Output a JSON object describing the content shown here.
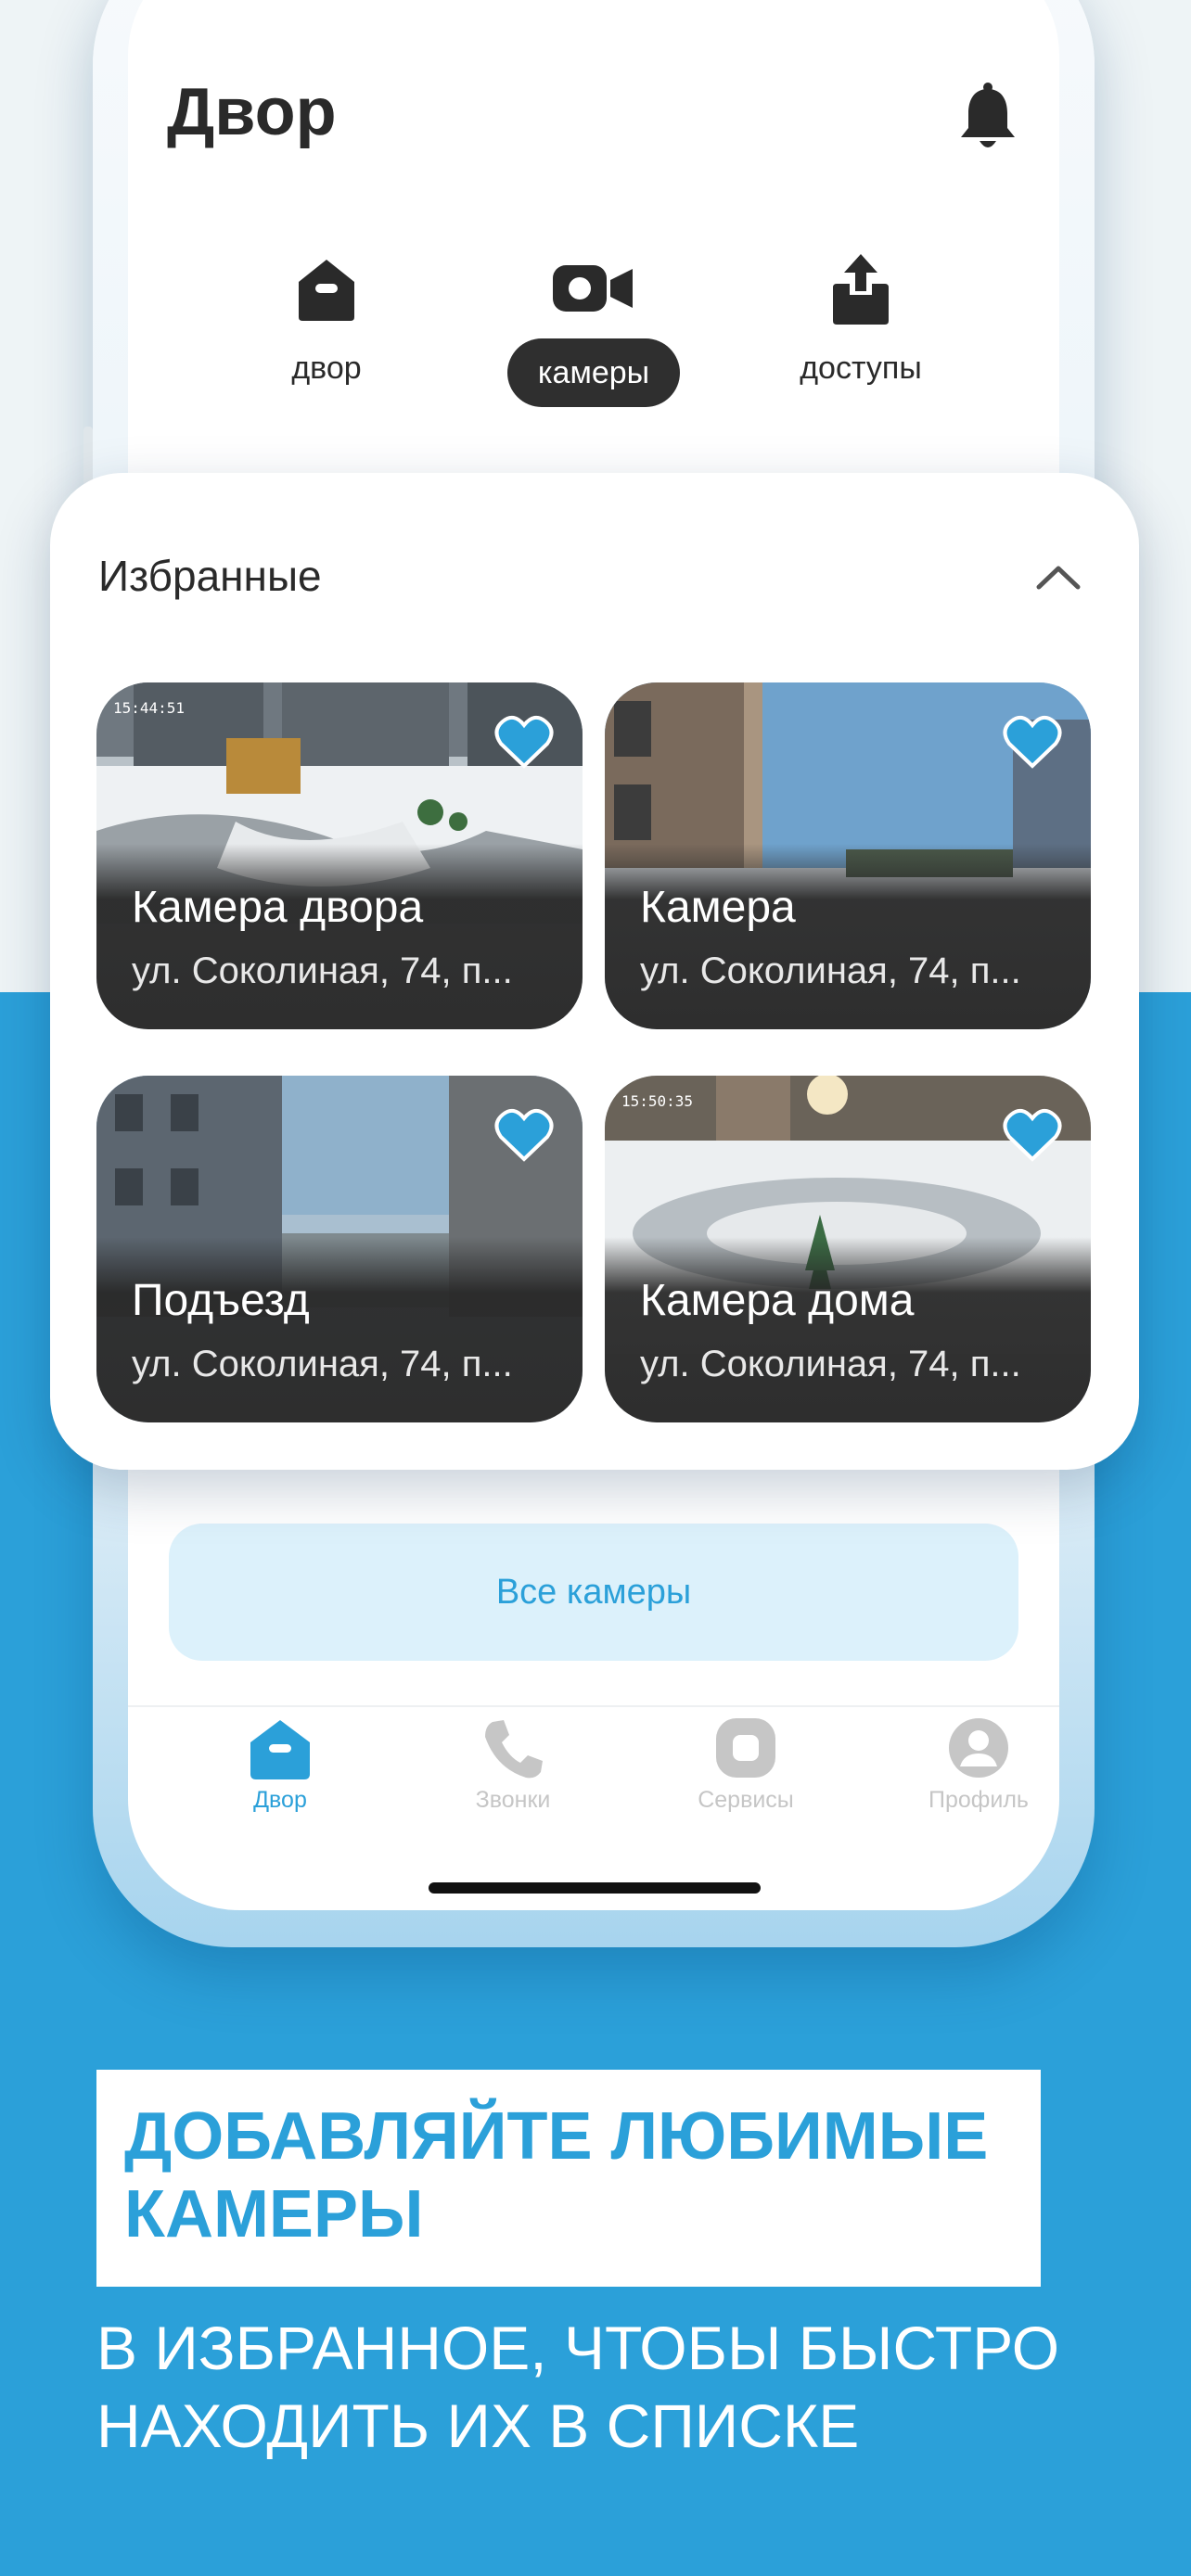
{
  "header": {
    "title": "Двор",
    "bell_icon": "bell-icon"
  },
  "segments": [
    {
      "label": "двор",
      "icon": "home-icon",
      "active": false
    },
    {
      "label": "камеры",
      "icon": "video-camera-icon",
      "active": true
    },
    {
      "label": "доступы",
      "icon": "share-icon",
      "active": false
    }
  ],
  "favorites": {
    "title": "Избранные",
    "collapse_icon": "chevron-up-icon",
    "cameras": [
      {
        "name": "Камера двора",
        "address": "ул. Соколиная, 74, п...",
        "timestamp": "15:44:51",
        "favorite": true
      },
      {
        "name": "Камера",
        "address": "ул. Соколиная, 74, п...",
        "timestamp": "",
        "favorite": true
      },
      {
        "name": "Подъезд",
        "address": "ул. Соколиная, 74, п...",
        "timestamp": "",
        "favorite": true
      },
      {
        "name": "Камера дома",
        "address": "ул. Соколиная, 74, п...",
        "timestamp": "15:50:35",
        "favorite": true
      }
    ]
  },
  "all_cameras_label": "Все камеры",
  "tabbar": [
    {
      "label": "Двор",
      "icon": "home-icon",
      "active": true
    },
    {
      "label": "Звонки",
      "icon": "phone-icon",
      "active": false
    },
    {
      "label": "Сервисы",
      "icon": "services-icon",
      "active": false
    },
    {
      "label": "Профиль",
      "icon": "profile-icon",
      "active": false
    }
  ],
  "promo": {
    "headline": "ДОБАВЛЯЙТЕ ЛЮБИМЫЕ\nКАМЕРЫ",
    "subtext": "В ИЗБРАННОЕ, ЧТОБЫ БЫСТРО\nНАХОДИТЬ ИХ В СПИСКЕ"
  },
  "colors": {
    "accent": "#2ba0d9",
    "dark": "#2f2f2f",
    "light_accent": "#dcf1fb"
  }
}
